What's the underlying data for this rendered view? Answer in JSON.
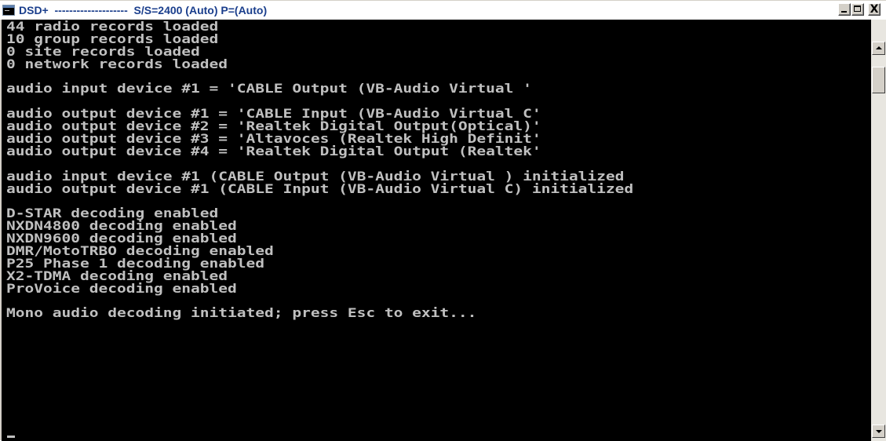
{
  "window": {
    "title": "DSD+  --------------------  S/S=2400 (Auto) P=(Auto)",
    "icon": "console-window-icon",
    "buttons": {
      "minimize": "minimize-icon",
      "maximize": "maximize-icon",
      "close_label": "X"
    }
  },
  "console": {
    "background": "#000000",
    "text_color": "#c0c0c0",
    "lines": [
      "44 radio records loaded",
      "10 group records loaded",
      "0 site records loaded",
      "0 network records loaded",
      "",
      "audio input device #1 = 'CABLE Output (VB-Audio Virtual '",
      "",
      "audio output device #1 = 'CABLE Input (VB-Audio Virtual C'",
      "audio output device #2 = 'Realtek Digital Output(Optical)'",
      "audio output device #3 = 'Altavoces (Realtek High Definit'",
      "audio output device #4 = 'Realtek Digital Output (Realtek'",
      "",
      "audio input device #1 (CABLE Output (VB-Audio Virtual ) initialized",
      "audio output device #1 (CABLE Input (VB-Audio Virtual C) initialized",
      "",
      "D-STAR decoding enabled",
      "NXDN4800 decoding enabled",
      "NXDN9600 decoding enabled",
      "DMR/MotoTRBO decoding enabled",
      "P25 Phase 1 decoding enabled",
      "X2-TDMA decoding enabled",
      "ProVoice decoding enabled",
      "",
      "Mono audio decoding initiated; press Esc to exit..."
    ]
  },
  "scrollbar": {
    "up_icon": "scroll-up-arrow-icon",
    "down_icon": "scroll-down-arrow-icon"
  }
}
